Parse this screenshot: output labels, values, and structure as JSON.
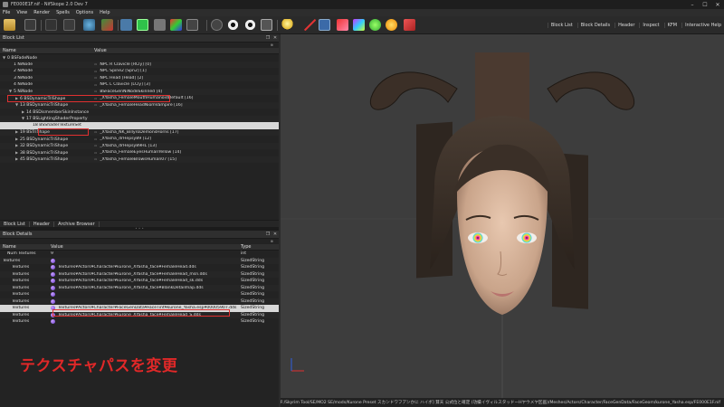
{
  "window": {
    "title": "FE000E1F.nif - NifSkope 2.0 Dev 7",
    "controls": [
      "–",
      "☐",
      "✕"
    ]
  },
  "menu": [
    "File",
    "View",
    "Render",
    "Spells",
    "Options",
    "Help"
  ],
  "toolbar_tabs": [
    "Block List",
    "Block Details",
    "Header",
    "Inspect",
    "KFM",
    "Interactive Help"
  ],
  "block_list": {
    "title": "Block List",
    "columns": {
      "name": "Name",
      "value": "Value"
    },
    "rows": [
      {
        "name": "0 BSFadeNode",
        "value": "",
        "indent": 0,
        "arrow": "▼"
      },
      {
        "name": "1 NiNode",
        "value": "NPC R Clavicle [RCly] [0]",
        "indent": 1,
        "arrow": ""
      },
      {
        "name": "2 NiNode",
        "value": "NPC Spine2 [Spn2] [1]",
        "indent": 1,
        "arrow": ""
      },
      {
        "name": "3 NiNode",
        "value": "NPC Head [Head] [2]",
        "indent": 1,
        "arrow": ""
      },
      {
        "name": "4 NiNode",
        "value": "NPC L Clavicle [LCly] [3]",
        "indent": 1,
        "arrow": ""
      },
      {
        "name": "5 NiNode",
        "value": "BSFaceGenNiNodeSkinned [4]",
        "indent": 1,
        "arrow": "▼"
      },
      {
        "name": "6 BSDynamicTriShape",
        "value": "_XYasha_FemaleMouthHumanoidDefault [16]",
        "indent": 2,
        "arrow": "▶"
      },
      {
        "name": "13 BSDynamicTriShape",
        "value": "_XYasha_FemaleHeadNiomVampire [16]",
        "indent": 2,
        "arrow": "▼"
      },
      {
        "name": "14 BSDismemberSkinInstance",
        "value": "",
        "indent": 3,
        "arrow": "▶"
      },
      {
        "name": "17 BSLightingShaderProperty",
        "value": "",
        "indent": 3,
        "arrow": "▼"
      },
      {
        "name": "18 BSShaderTextureSet",
        "value": "",
        "indent": 4,
        "arrow": ""
      },
      {
        "name": "19 BSTriShape",
        "value": "_XYasha_NK_BillyroDemonsHorns [17]",
        "indent": 2,
        "arrow": "▶"
      },
      {
        "name": "25 BSDynamicTriShape",
        "value": "_XYasha_drHepsy89 [12]",
        "indent": 2,
        "arrow": "▶"
      },
      {
        "name": "32 BSDynamicTriShape",
        "value": "_XYasha_drHepsy89HL [13]",
        "indent": 2,
        "arrow": "▶"
      },
      {
        "name": "38 BSDynamicTriShape",
        "value": "_XYasha_FemaleEyesHumanYellow [14]",
        "indent": 2,
        "arrow": "▶"
      },
      {
        "name": "45 BSDynamicTriShape",
        "value": "_XYasha_FemaleBrowsHuman07 [15]",
        "indent": 2,
        "arrow": "▶"
      }
    ]
  },
  "bottom_tabs": [
    "Block List",
    "Header",
    "Archive Browser"
  ],
  "block_details": {
    "title": "Block Details",
    "columns": {
      "name": "Name",
      "value": "Value",
      "type": "Type"
    },
    "rows": [
      {
        "name": "Num Textures",
        "value": "9",
        "type": "int",
        "icon": false,
        "indent": 1
      },
      {
        "name": "Textures",
        "value": "",
        "type": "SizedString",
        "icon": true,
        "indent": 0
      },
      {
        "name": "Textures",
        "value": "Textures¥Actors¥Character¥kurone_XYasha_face¥FemaleHead.dds",
        "type": "SizedString",
        "icon": true,
        "indent": 2
      },
      {
        "name": "Textures",
        "value": "Textures¥Actors¥Character¥kurone_XYasha_face¥FemaleHead_msn.dds",
        "type": "SizedString",
        "icon": true,
        "indent": 2
      },
      {
        "name": "Textures",
        "value": "Textures¥Actors¥Character¥kurone_XYasha_face¥FemaleHead_sk.dds",
        "type": "SizedString",
        "icon": true,
        "indent": 2
      },
      {
        "name": "Textures",
        "value": "Textures¥Actors¥Character¥kurone_XYasha_face¥BlankDetailmap.dds",
        "type": "SizedString",
        "icon": true,
        "indent": 2
      },
      {
        "name": "Textures",
        "value": "",
        "type": "SizedString",
        "icon": true,
        "indent": 2
      },
      {
        "name": "Textures",
        "value": "",
        "type": "SizedString",
        "icon": true,
        "indent": 2
      },
      {
        "name": "Textures",
        "value": "Textures¥Actors¥Character¥FaceGenData¥FaceTint¥kurone_Yasha.esp¥00005907.dds",
        "type": "SizedString",
        "icon": true,
        "indent": 2
      },
      {
        "name": "Textures",
        "value": "Textures¥Actors¥Character¥kurone_XYasha_face¥FemaleHead_S.dds",
        "type": "SizedString",
        "icon": true,
        "indent": 2
      },
      {
        "name": "Textures",
        "value": "",
        "type": "SizedString",
        "icon": true,
        "indent": 2
      }
    ]
  },
  "caption": "テクスチャパスを変更",
  "status_path": "F:/Skyrim Tool/SE/MO2 SE/mods/Kurone Preset スカンドワフアンかに ハイボ] 茸天 公式位と確定 (功績イヴィルスタッドーHヤウメヤ区画)/Meshes/Actors/Character/FaceGenData/FaceGeom/kurone_Yasha.esp/FE000E1F.nif"
}
